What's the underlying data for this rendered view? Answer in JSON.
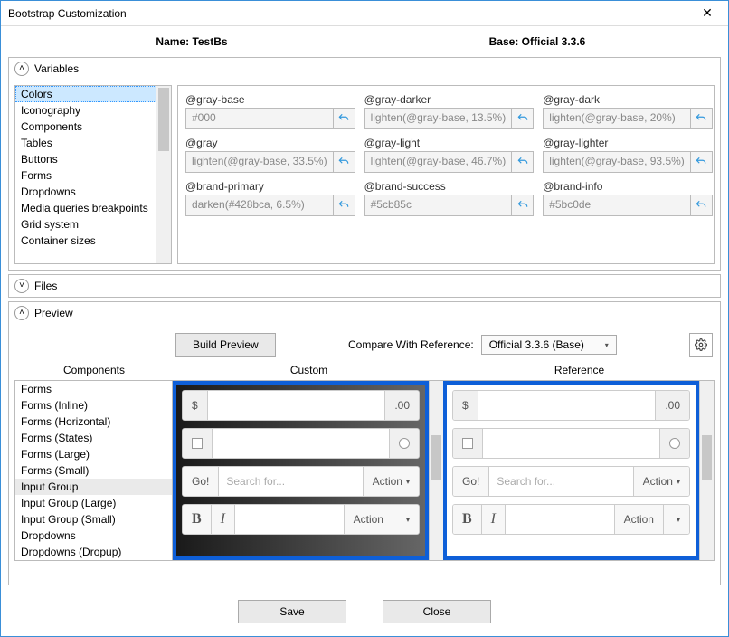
{
  "window": {
    "title": "Bootstrap Customization"
  },
  "info": {
    "name_label": "Name: ",
    "name": "TestBs",
    "base_label": "Base: ",
    "base": "Official 3.3.6"
  },
  "sections": {
    "variables": "Variables",
    "files": "Files",
    "preview": "Preview"
  },
  "var_categories": [
    "Colors",
    "Iconography",
    "Components",
    "Tables",
    "Buttons",
    "Forms",
    "Dropdowns",
    "Media queries breakpoints",
    "Grid system",
    "Container sizes"
  ],
  "var_selected": 0,
  "variables": [
    {
      "name": "@gray-base",
      "value": "#000"
    },
    {
      "name": "@gray-darker",
      "value": "lighten(@gray-base, 13.5%)"
    },
    {
      "name": "@gray-dark",
      "value": "lighten(@gray-base, 20%)"
    },
    {
      "name": "@gray",
      "value": "lighten(@gray-base, 33.5%)"
    },
    {
      "name": "@gray-light",
      "value": "lighten(@gray-base, 46.7%)"
    },
    {
      "name": "@gray-lighter",
      "value": "lighten(@gray-base, 93.5%)"
    },
    {
      "name": "@brand-primary",
      "value": "darken(#428bca, 6.5%)"
    },
    {
      "name": "@brand-success",
      "value": "#5cb85c"
    },
    {
      "name": "@brand-info",
      "value": "#5bc0de"
    }
  ],
  "preview": {
    "build_btn": "Build Preview",
    "compare_label": "Compare With Reference:",
    "reference_selected": "Official 3.3.6 (Base)",
    "headers": {
      "components": "Components",
      "custom": "Custom",
      "reference": "Reference"
    }
  },
  "components": [
    "Forms",
    "Forms (Inline)",
    "Forms (Horizontal)",
    "Forms (States)",
    "Forms (Large)",
    "Forms (Small)",
    "Input Group",
    "Input Group (Large)",
    "Input Group (Small)",
    "Dropdowns",
    "Dropdowns (Dropup)"
  ],
  "components_selected": 6,
  "sample": {
    "dollar": "$",
    "cents": ".00",
    "go": "Go!",
    "search_ph": "Search for...",
    "action": "Action",
    "bold": "B",
    "ital": "I"
  },
  "footer": {
    "save": "Save",
    "close": "Close"
  }
}
